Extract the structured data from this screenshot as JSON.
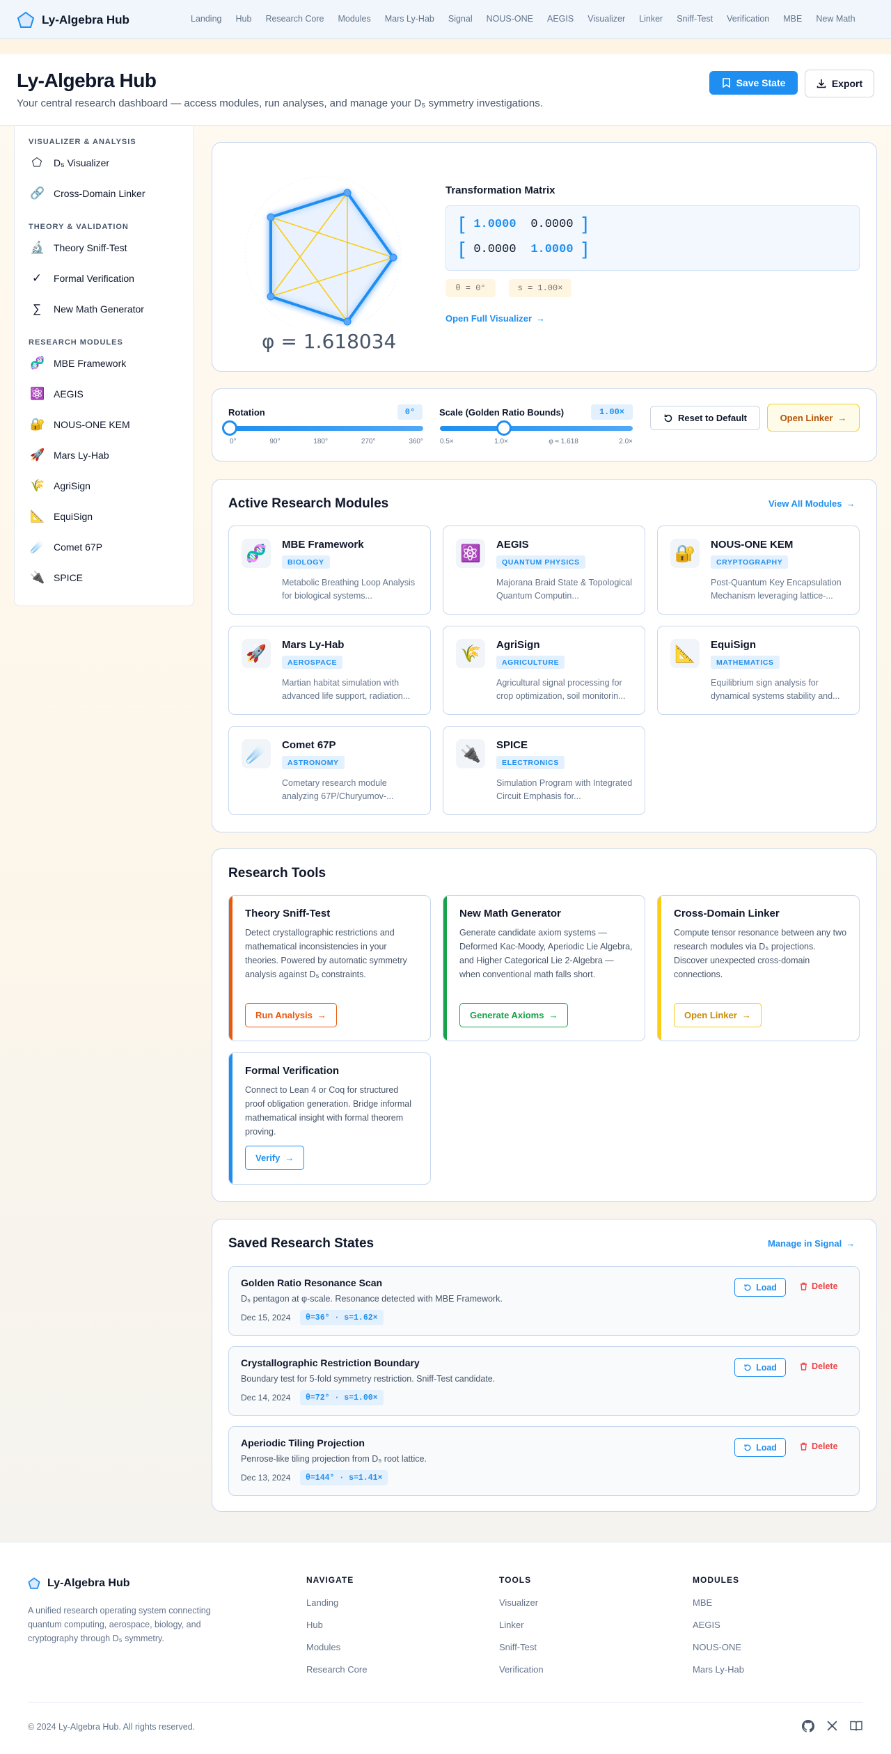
{
  "app": {
    "name": "Ly-Algebra Hub"
  },
  "topnav": {
    "links": [
      "Landing",
      "Hub",
      "Research Core",
      "Modules",
      "Mars Ly-Hab",
      "Signal",
      "NOUS-ONE",
      "AEGIS",
      "Visualizer",
      "Linker",
      "Sniff-Test",
      "Verification",
      "MBE",
      "New Math"
    ]
  },
  "header": {
    "title": "Ly-Algebra Hub",
    "subtitle": "Your central research dashboard — access modules, run analyses, and manage your D₅ symmetry investigations.",
    "save_label": "Save State",
    "export_label": "Export"
  },
  "sidebar": {
    "sections": [
      {
        "title": "VISUALIZER & ANALYSIS",
        "items": [
          {
            "label": "D₅ Visualizer",
            "icon": "pentagon-icon",
            "glyph": "⬠"
          },
          {
            "label": "Cross-Domain Linker",
            "icon": "link-icon",
            "glyph": "🔗"
          }
        ]
      },
      {
        "title": "THEORY & VALIDATION",
        "items": [
          {
            "label": "Theory Sniff-Test",
            "icon": "microscope-icon",
            "glyph": "🔬"
          },
          {
            "label": "Formal Verification",
            "icon": "check-icon",
            "glyph": "✓"
          },
          {
            "label": "New Math Generator",
            "icon": "sigma-icon",
            "glyph": "∑"
          }
        ]
      },
      {
        "title": "RESEARCH MODULES",
        "items": [
          {
            "label": "MBE Framework",
            "icon": "dna-icon",
            "glyph": "🧬"
          },
          {
            "label": "AEGIS",
            "icon": "atom-icon",
            "glyph": "⚛️"
          },
          {
            "label": "NOUS-ONE KEM",
            "icon": "lock-key-icon",
            "glyph": "🔐"
          },
          {
            "label": "Mars Ly-Hab",
            "icon": "rocket-icon",
            "glyph": "🚀"
          },
          {
            "label": "AgriSign",
            "icon": "wheat-icon",
            "glyph": "🌾"
          },
          {
            "label": "EquiSign",
            "icon": "triangle-ruler-icon",
            "glyph": "📐"
          },
          {
            "label": "Comet 67P",
            "icon": "comet-icon",
            "glyph": "☄️"
          },
          {
            "label": "SPICE",
            "icon": "plug-icon",
            "glyph": "🔌"
          }
        ]
      }
    ]
  },
  "visualizer": {
    "phi_text": "φ = 1.618034",
    "matrix_title": "Transformation Matrix",
    "matrix": [
      [
        "1.0000",
        "0.0000"
      ],
      [
        "0.0000",
        "1.0000"
      ]
    ],
    "theta_chip": "θ = 0°",
    "scale_chip": "s = 1.00×",
    "open_label": "Open Full Visualizer"
  },
  "controls": {
    "rotation": {
      "label": "Rotation",
      "value_text": "0°",
      "value": 0,
      "min": 0,
      "max": 360,
      "ticks": [
        "0°",
        "90°",
        "180°",
        "270°",
        "360°"
      ]
    },
    "scale": {
      "label": "Scale (Golden Ratio Bounds)",
      "value_text": "1.00×",
      "value": 1.0,
      "min": 0.5,
      "max": 2.0,
      "ticks": [
        "0.5×",
        "1.0×",
        "φ ≈ 1.618",
        "2.0×"
      ]
    },
    "reset_label": "Reset to Default",
    "linker_label": "Open Linker"
  },
  "modules": {
    "title": "Active Research Modules",
    "view_all": "View All Modules",
    "cards": [
      {
        "title": "MBE Framework",
        "tag": "BIOLOGY",
        "desc": "Metabolic Breathing Loop Analysis for biological systems...",
        "glyph": "🧬"
      },
      {
        "title": "AEGIS",
        "tag": "QUANTUM PHYSICS",
        "desc": "Majorana Braid State & Topological Quantum Computin...",
        "glyph": "⚛️"
      },
      {
        "title": "NOUS-ONE KEM",
        "tag": "CRYPTOGRAPHY",
        "desc": "Post-Quantum Key Encapsulation Mechanism leveraging lattice-...",
        "glyph": "🔐"
      },
      {
        "title": "Mars Ly-Hab",
        "tag": "AEROSPACE",
        "desc": "Martian habitat simulation with advanced life support, radiation...",
        "glyph": "🚀"
      },
      {
        "title": "AgriSign",
        "tag": "AGRICULTURE",
        "desc": "Agricultural signal processing for crop optimization, soil monitorin...",
        "glyph": "🌾"
      },
      {
        "title": "EquiSign",
        "tag": "MATHEMATICS",
        "desc": "Equilibrium sign analysis for dynamical systems stability and...",
        "glyph": "📐"
      },
      {
        "title": "Comet 67P",
        "tag": "ASTRONOMY",
        "desc": "Cometary research module analyzing 67P/Churyumov-...",
        "glyph": "☄️"
      },
      {
        "title": "SPICE",
        "tag": "ELECTRONICS",
        "desc": "Simulation Program with Integrated Circuit Emphasis for...",
        "glyph": "🔌"
      }
    ]
  },
  "tools": {
    "title": "Research Tools",
    "cards": [
      {
        "title": "Theory Sniff-Test",
        "desc": "Detect crystallographic restrictions and mathematical inconsistencies in your theories. Powered by automatic symmetry analysis against D₅ constraints.",
        "button": "Run Analysis",
        "color": "#ea580c"
      },
      {
        "title": "New Math Generator",
        "desc": "Generate candidate axiom systems — Deformed Kac-Moody, Aperiodic Lie Algebra, and Higher Categorical Lie 2-Algebra — when conventional math falls short.",
        "button": "Generate Axioms",
        "color": "#16a34a"
      },
      {
        "title": "Cross-Domain Linker",
        "desc": "Compute tensor resonance between any two research modules via D₅ projections. Discover unexpected cross-domain connections.",
        "button": "Open Linker",
        "color": "#facc15"
      },
      {
        "title": "Formal Verification",
        "desc": "Connect to Lean 4 or Coq for structured proof obligation generation. Bridge informal mathematical insight with formal theorem proving.",
        "button": "Verify",
        "color": "#1e8ff0"
      }
    ]
  },
  "saved": {
    "title": "Saved Research States",
    "manage": "Manage in Signal",
    "load_label": "Load",
    "delete_label": "Delete",
    "states": [
      {
        "title": "Golden Ratio Resonance Scan",
        "desc": "D₅ pentagon at φ-scale. Resonance detected with MBE Framework.",
        "date": "Dec 15, 2024",
        "params": "θ=36° · s=1.62×"
      },
      {
        "title": "Crystallographic Restriction Boundary",
        "desc": "Boundary test for 5-fold symmetry restriction. Sniff-Test candidate.",
        "date": "Dec 14, 2024",
        "params": "θ=72° · s=1.00×"
      },
      {
        "title": "Aperiodic Tiling Projection",
        "desc": "Penrose-like tiling projection from D₅ root lattice.",
        "date": "Dec 13, 2024",
        "params": "θ=144° · s=1.41×"
      }
    ]
  },
  "footer": {
    "brand": "Ly-Algebra Hub",
    "desc": "A unified research operating system connecting quantum computing, aerospace, biology, and cryptography through D₅ symmetry.",
    "columns": [
      {
        "title": "NAVIGATE",
        "links": [
          "Landing",
          "Hub",
          "Modules",
          "Research Core"
        ]
      },
      {
        "title": "TOOLS",
        "links": [
          "Visualizer",
          "Linker",
          "Sniff-Test",
          "Verification"
        ]
      },
      {
        "title": "MODULES",
        "links": [
          "MBE",
          "AEGIS",
          "NOUS-ONE",
          "Mars Ly-Hab"
        ]
      }
    ],
    "copyright": "© 2024 Ly-Algebra Hub. All rights reserved.",
    "icons": [
      "github-icon",
      "x-icon",
      "book-icon"
    ]
  },
  "colors": {
    "accent": "#1e8ff0",
    "danger": "#ef4444",
    "warning": "#facc15",
    "success": "#16a34a",
    "orange": "#ea580c"
  }
}
